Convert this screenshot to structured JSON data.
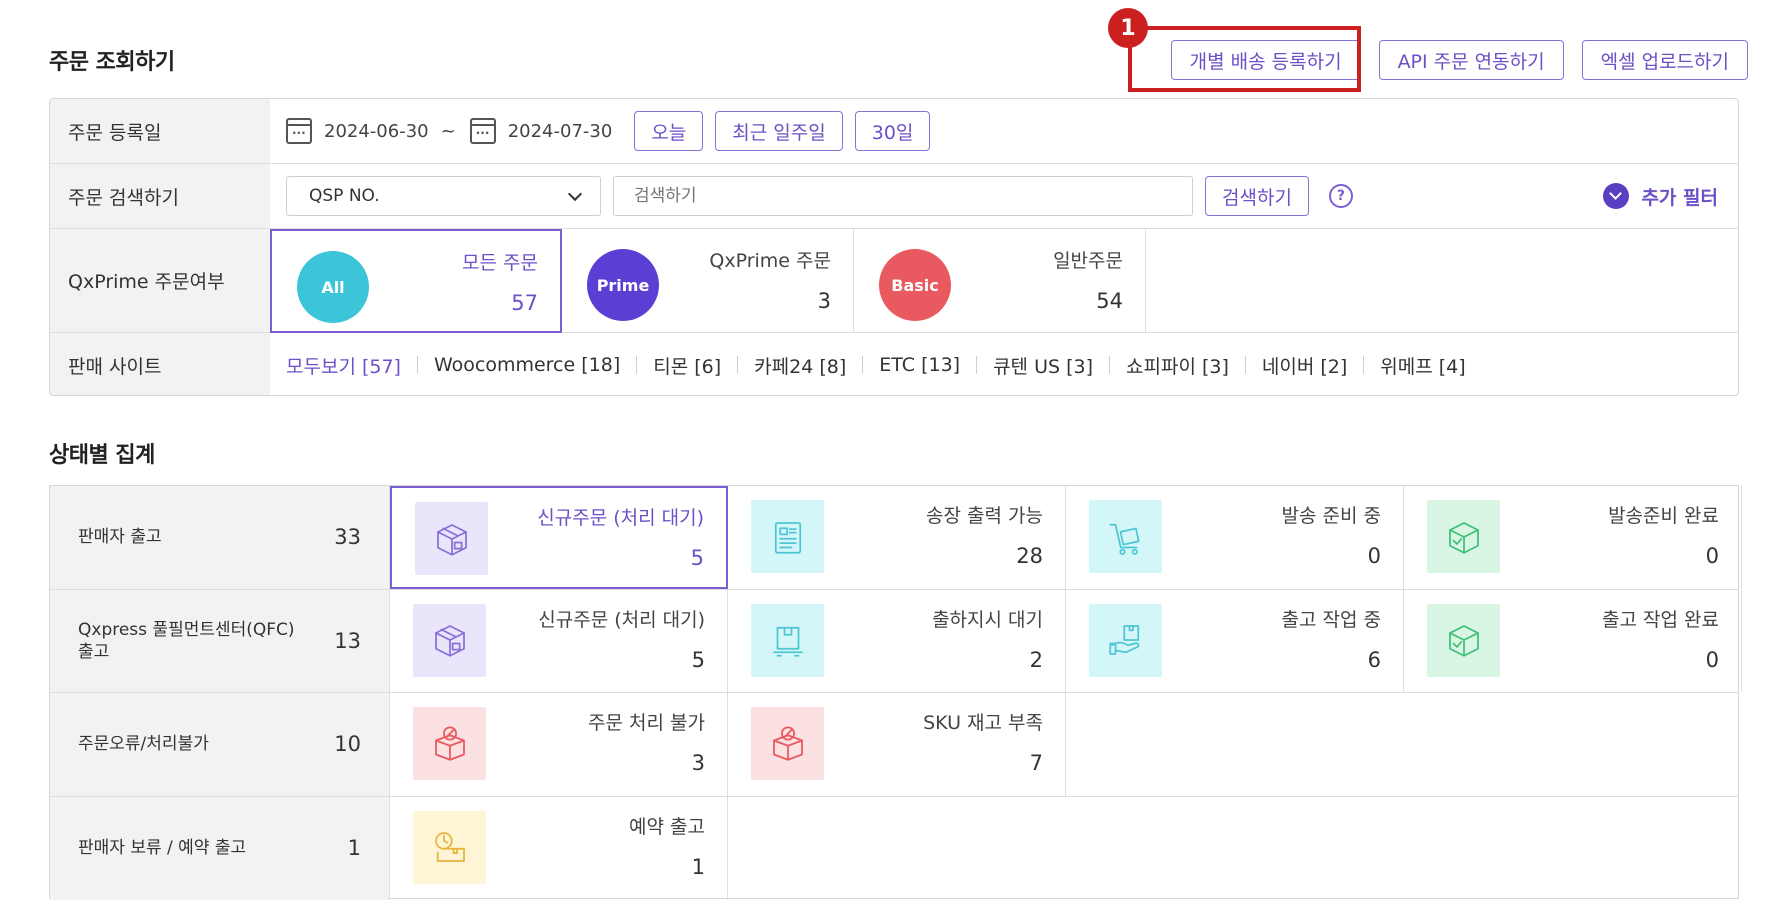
{
  "sections": {
    "order_search_title": "주문 조회하기",
    "status_title": "상태별 집계"
  },
  "top_buttons": {
    "individual": "개별 배송 등록하기",
    "api": "API 주문 연동하기",
    "excel": "엑셀 업로드하기"
  },
  "annotation": {
    "marker": "1",
    "color": "#cc1f1f"
  },
  "filters": {
    "date": {
      "label": "주문 등록일",
      "from": "2024-06-30",
      "tilde": "~",
      "to": "2024-07-30",
      "today": "오늘",
      "week": "최근 일주일",
      "days30": "30일"
    },
    "search": {
      "label": "주문 검색하기",
      "select_value": "QSP NO.",
      "placeholder": "검색하기",
      "button": "검색하기",
      "help": "?",
      "add_filter": "추가 필터"
    },
    "prime": {
      "label": "QxPrime 주문여부",
      "options": [
        {
          "badge": "All",
          "name": "모든 주문",
          "count": "57",
          "color": "#3cc5d9"
        },
        {
          "badge": "Prime",
          "name": "QxPrime 주문",
          "count": "3",
          "color": "#5b3fd4"
        },
        {
          "badge": "Basic",
          "name": "일반주문",
          "count": "54",
          "color": "#e85a5f"
        }
      ]
    },
    "sites": {
      "label": "판매 사이트",
      "items": [
        "모두보기 [57]",
        "Woocommerce [18]",
        "티몬 [6]",
        "카페24 [8]",
        "ETC [13]",
        "큐텐 US [3]",
        "쇼피파이 [3]",
        "네이버 [2]",
        "위메프 [4]"
      ]
    }
  },
  "status": {
    "rows": [
      {
        "label": "판매자 출고",
        "count": "33",
        "cells": [
          {
            "name": "신규주문 (처리 대기)",
            "count": "5",
            "icon": "box-icon"
          },
          {
            "name": "송장 출력 가능",
            "count": "28",
            "icon": "invoice-icon"
          },
          {
            "name": "발송 준비 중",
            "count": "0",
            "icon": "cart-icon"
          },
          {
            "name": "발송준비 완료",
            "count": "0",
            "icon": "box-check-icon"
          }
        ]
      },
      {
        "label": "Qxpress 풀필먼트센터(QFC)",
        "label2": "출고",
        "count": "13",
        "cells": [
          {
            "name": "신규주문 (처리 대기)",
            "count": "5",
            "icon": "box-icon"
          },
          {
            "name": "출하지시 대기",
            "count": "2",
            "icon": "package-icon"
          },
          {
            "name": "출고 작업 중",
            "count": "6",
            "icon": "hand-box-icon"
          },
          {
            "name": "출고 작업 완료",
            "count": "0",
            "icon": "box-check-icon"
          }
        ]
      },
      {
        "label": "주문오류/처리불가",
        "count": "10",
        "cells": [
          {
            "name": "주문 처리 불가",
            "count": "3",
            "icon": "box-error-icon"
          },
          {
            "name": "SKU 재고 부족",
            "count": "7",
            "icon": "box-error-icon"
          }
        ]
      },
      {
        "label": "판매자 보류 / 예약 출고",
        "count": "1",
        "cells": [
          {
            "name": "예약 출고",
            "count": "1",
            "icon": "clock-box-icon"
          }
        ]
      }
    ]
  }
}
